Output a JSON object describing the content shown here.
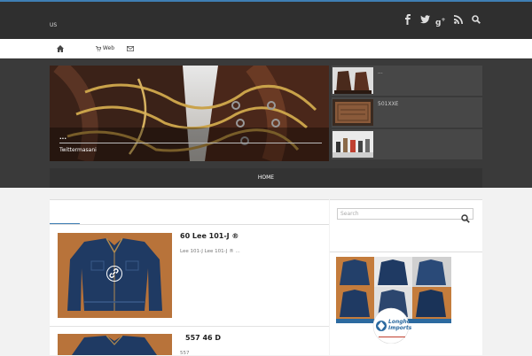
{
  "site": {
    "title": "US"
  },
  "social": [
    {
      "name": "facebook-icon",
      "glyph": "f"
    },
    {
      "name": "twitter-icon",
      "glyph": "t"
    },
    {
      "name": "google-plus-icon",
      "glyph": "g+"
    },
    {
      "name": "rss-icon",
      "glyph": "rss"
    },
    {
      "name": "search-icon",
      "glyph": "search"
    }
  ],
  "nav": {
    "web_label": "Web"
  },
  "hero": {
    "title": "...",
    "caption": "Twittermasani"
  },
  "side_items": [
    {
      "label": "..."
    },
    {
      "label": "501XXE"
    },
    {
      "label": ""
    }
  ],
  "menu": {
    "home": "HOME"
  },
  "search": {
    "placeholder": "Search"
  },
  "posts": [
    {
      "title": "60 Lee 101-J ®",
      "excerpt": "Lee 101-J Lee 101-J  ® ..."
    },
    {
      "title": "557 46 D",
      "excerpt": "557"
    }
  ],
  "ad": {
    "brand_line1": "Longhorn",
    "brand_line2": "Imports"
  },
  "colors": {
    "accent": "#3f7fb4",
    "topbar": "#2f2f2f",
    "hero_bg": "#3a3a3a",
    "menubar": "#333333"
  }
}
